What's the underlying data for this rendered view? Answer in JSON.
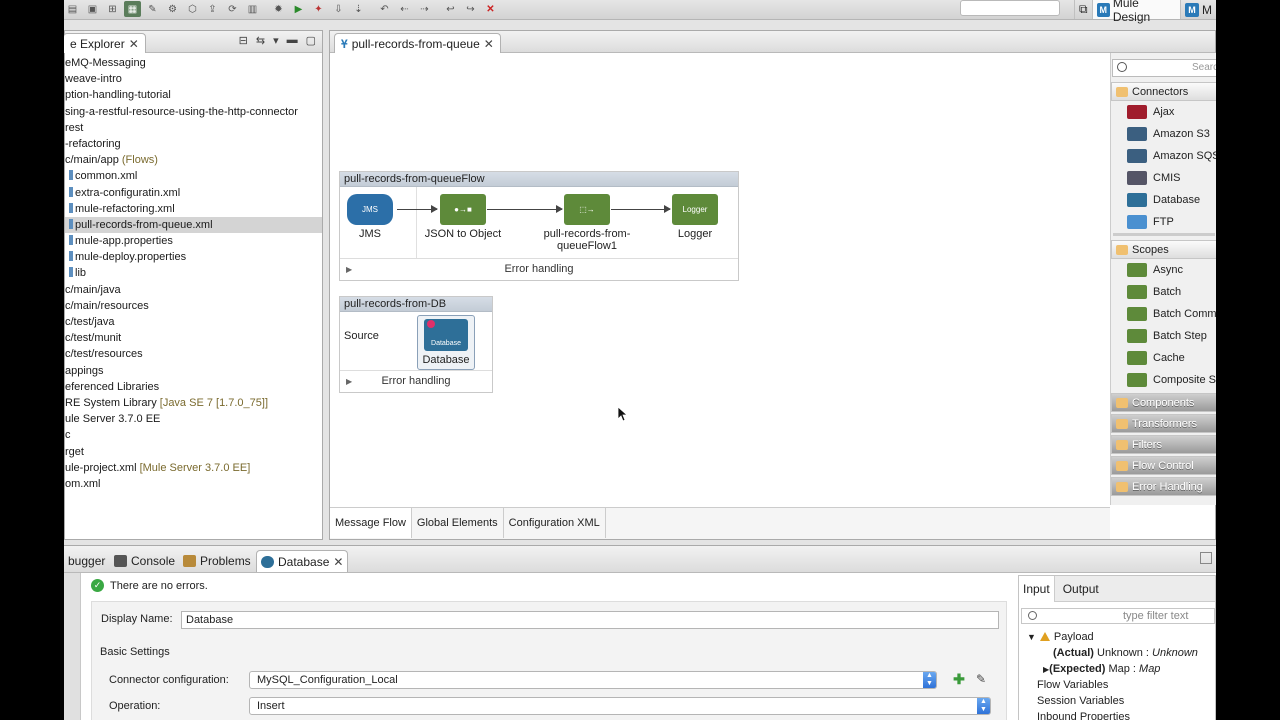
{
  "toolbar": {
    "perspectives": [
      {
        "label": "Mule Design"
      },
      {
        "label": "M"
      }
    ]
  },
  "explorer": {
    "tab_label": "e Explorer",
    "items": [
      {
        "text": "eMQ-Messaging",
        "dec": ""
      },
      {
        "text": "weave-intro",
        "dec": ""
      },
      {
        "text": "ption-handling-tutorial",
        "dec": ""
      },
      {
        "text": "sing-a-restful-resource-using-the-http-connector",
        "dec": ""
      },
      {
        "text": "rest",
        "dec": ""
      },
      {
        "text": "-refactoring",
        "dec": ""
      },
      {
        "text": "c/main/app",
        "dec": " (Flows)"
      },
      {
        "text": "common.xml",
        "dec": ""
      },
      {
        "text": "extra-configuratin.xml",
        "dec": ""
      },
      {
        "text": "mule-refactoring.xml",
        "dec": ""
      },
      {
        "text": "pull-records-from-queue.xml",
        "dec": ""
      },
      {
        "text": "mule-app.properties",
        "dec": ""
      },
      {
        "text": "mule-deploy.properties",
        "dec": ""
      },
      {
        "text": "lib",
        "dec": ""
      },
      {
        "text": "c/main/java",
        "dec": ""
      },
      {
        "text": "c/main/resources",
        "dec": ""
      },
      {
        "text": "c/test/java",
        "dec": ""
      },
      {
        "text": "c/test/munit",
        "dec": ""
      },
      {
        "text": "c/test/resources",
        "dec": ""
      },
      {
        "text": "appings",
        "dec": ""
      },
      {
        "text": "eferenced Libraries",
        "dec": ""
      },
      {
        "text": "RE System Library",
        "dec": " [Java SE 7 [1.7.0_75]]"
      },
      {
        "text": "ule Server 3.7.0 EE",
        "dec": ""
      },
      {
        "text": "c",
        "dec": ""
      },
      {
        "text": "rget",
        "dec": ""
      },
      {
        "text": "ule-project.xml",
        "dec": " [Mule Server 3.7.0 EE]"
      },
      {
        "text": "om.xml",
        "dec": ""
      }
    ]
  },
  "editor": {
    "tab_label": "pull-records-from-queue",
    "flow1": {
      "title": "pull-records-from-queueFlow",
      "processors": [
        {
          "label": "JMS",
          "icon_text": "JMS"
        },
        {
          "label": "JSON to Object",
          "icon_text": ""
        },
        {
          "label": "pull-records-from-queueFlow1",
          "icon_text": ""
        },
        {
          "label": "Logger",
          "icon_text": "Logger"
        }
      ],
      "error_label": "Error handling"
    },
    "flow2": {
      "title": "pull-records-from-DB",
      "source_label": "Source",
      "processor_label": "Database",
      "processor_icon_text": "Database",
      "error_label": "Error handling"
    },
    "bottom_tabs": [
      "Message Flow",
      "Global Elements",
      "Configuration XML"
    ]
  },
  "palette": {
    "search_placeholder": "Search",
    "groups": {
      "connectors": "Connectors",
      "scopes": "Scopes",
      "components": "Components",
      "transformers": "Transformers",
      "filters": "Filters",
      "flow_control": "Flow Control",
      "error_handling": "Error Handling"
    },
    "connectors": [
      "Ajax",
      "Amazon S3",
      "Amazon SQS",
      "CMIS",
      "Database",
      "FTP"
    ],
    "scopes": [
      "Async",
      "Batch",
      "Batch Commi",
      "Batch Step",
      "Cache",
      "Composite So"
    ]
  },
  "bottom": {
    "tabs": [
      "bugger",
      "Console",
      "Problems",
      "Database"
    ],
    "status": "There are no errors.",
    "display_name_label": "Display Name:",
    "display_name_value": "Database",
    "basic_settings": "Basic Settings",
    "connector_config_label": "Connector configuration:",
    "connector_config_value": "MySQL_Configuration_Local",
    "operation_label": "Operation:",
    "operation_value": "Insert"
  },
  "io_panel": {
    "tabs": [
      "Input",
      "Output"
    ],
    "filter_placeholder": "type filter text",
    "payload": "Payload",
    "actual_key": "(Actual)",
    "actual_val": " Unknown : ",
    "actual_type": "Unknown",
    "expected_key": "(Expected)",
    "expected_val": " Map : ",
    "expected_type": "Map",
    "flow_vars": "Flow Variables",
    "session_vars": "Session Variables",
    "inbound_props": "Inbound Properties"
  },
  "colors": {
    "jms": "#2c6fa8",
    "transformer": "#5e8a3a",
    "database": "#2e6f98",
    "selection": "#d4d4d4"
  }
}
